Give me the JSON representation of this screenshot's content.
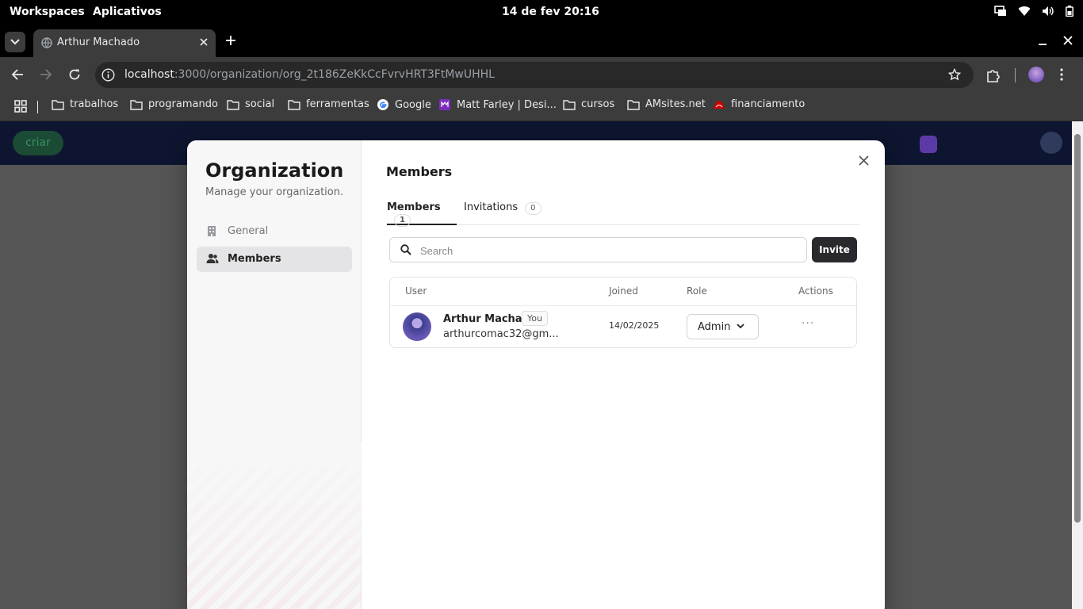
{
  "os": {
    "workspaces": "Workspaces",
    "apps": "Aplicativos",
    "clock": "14 de fev  20:16"
  },
  "browser": {
    "tab_title": "Arthur Machado",
    "url_host": "localhost",
    "url_path": ":3000/organization/org_2t186ZeKkCcFvrvHRT3FtMwUHHL"
  },
  "bookmarks": [
    {
      "label": "trabalhos",
      "icon": "folder-icon"
    },
    {
      "label": "programando",
      "icon": "folder-icon"
    },
    {
      "label": "social",
      "icon": "folder-icon"
    },
    {
      "label": "ferramentas",
      "icon": "folder-icon"
    },
    {
      "label": "Google",
      "icon": "google-icon"
    },
    {
      "label": "Matt Farley | Desi...",
      "icon": "matt-farley-icon"
    },
    {
      "label": "cursos",
      "icon": "folder-icon"
    },
    {
      "label": "AMsites.net",
      "icon": "folder-icon"
    },
    {
      "label": "financiamento",
      "icon": "bank-icon"
    }
  ],
  "page": {
    "criar_label": "criar"
  },
  "modal": {
    "sidebar": {
      "title": "Organization",
      "subtitle": "Manage your organization.",
      "items": [
        {
          "label": "General",
          "icon": "building-icon",
          "active": false
        },
        {
          "label": "Members",
          "icon": "users-icon",
          "active": true
        }
      ]
    },
    "main": {
      "title": "Members",
      "tabs": [
        {
          "label": "Members",
          "count": "1",
          "active": true
        },
        {
          "label": "Invitations",
          "count": "0",
          "active": false
        }
      ],
      "search_placeholder": "Search",
      "invite_label": "Invite",
      "table": {
        "headers": {
          "user": "User",
          "joined": "Joined",
          "role": "Role",
          "actions": "Actions"
        },
        "rows": [
          {
            "name": "Arthur Machado",
            "badge": "You",
            "email": "arthurcomac32@gm...",
            "joined": "14/02/2025",
            "role": "Admin",
            "actions": "···"
          }
        ]
      }
    }
  },
  "colors": {
    "accent_dark": "#2a2a2e",
    "header_navy": "#0d1530",
    "criar_green": "#1b4b34"
  }
}
